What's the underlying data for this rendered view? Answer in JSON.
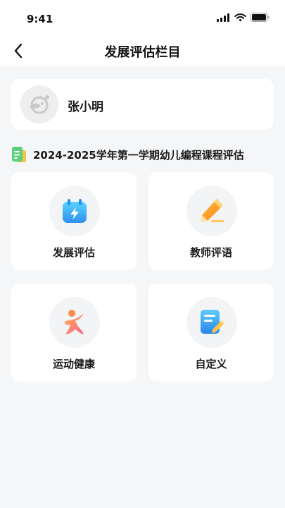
{
  "status_bar": {
    "time": "9:41"
  },
  "nav": {
    "title": "发展评估栏目"
  },
  "profile": {
    "name": "张小明"
  },
  "section": {
    "title": "2024-2025学年第一学期幼儿编程课程评估"
  },
  "tiles": [
    {
      "label": "发展评估",
      "icon": "calendar-bolt-icon"
    },
    {
      "label": "教师评语",
      "icon": "pencil-icon"
    },
    {
      "label": "运动健康",
      "icon": "running-figure-icon"
    },
    {
      "label": "自定义",
      "icon": "note-edit-icon"
    }
  ],
  "colors": {
    "background": "#f5f6f8",
    "card": "#ffffff",
    "icon_circle": "#f3f4f6",
    "section_icon_green": "#5bd07a",
    "section_icon_yellow": "#f6c344"
  }
}
